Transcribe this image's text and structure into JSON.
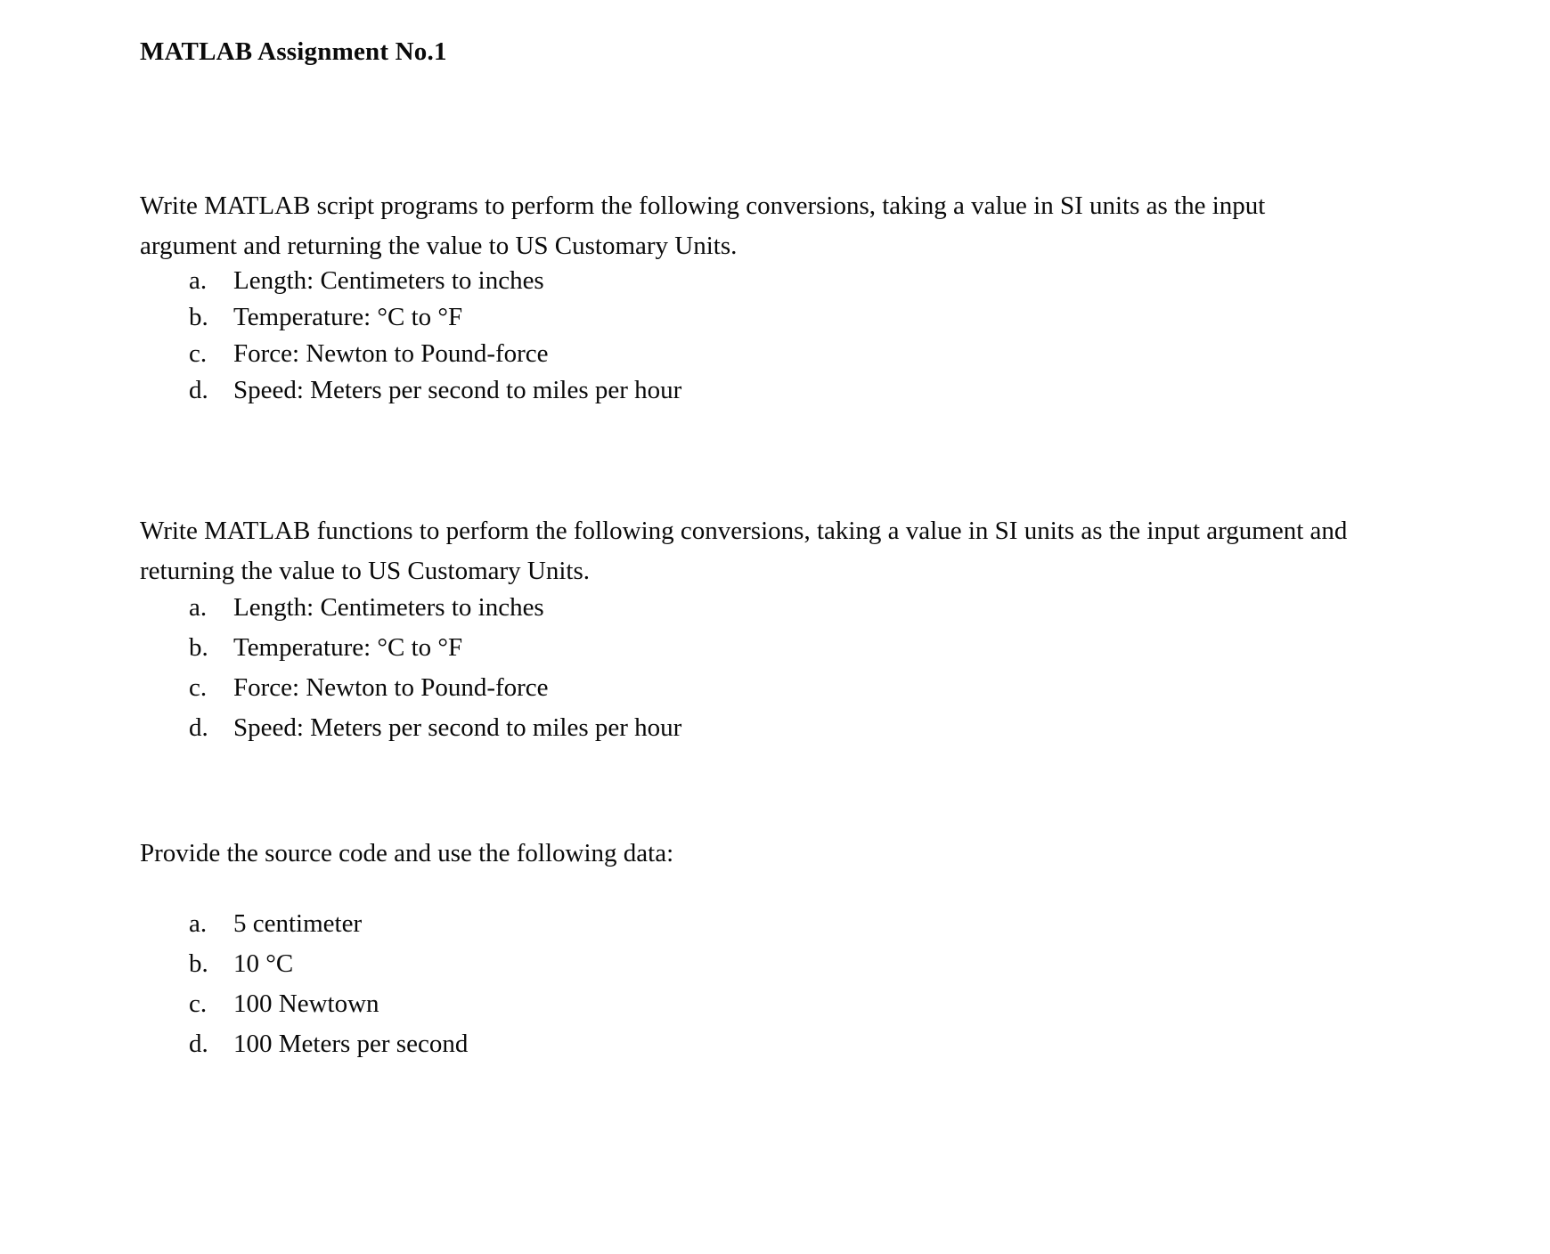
{
  "document": {
    "title": "MATLAB Assignment No.1",
    "sections": [
      {
        "id": "scripts",
        "paragraph": "Write MATLAB script programs to perform the following conversions, taking a value in SI units as the input argument and returning the value to US Customary Units.",
        "items": [
          {
            "marker": "a.",
            "text": "Length: Centimeters to inches"
          },
          {
            "marker": "b.",
            "text": "Temperature: °C to °F"
          },
          {
            "marker": "c.",
            "text": "Force: Newton to Pound-force"
          },
          {
            "marker": "d.",
            "text": "Speed: Meters per second to miles per hour"
          }
        ]
      },
      {
        "id": "functions",
        "paragraph": "Write MATLAB functions to perform the following conversions, taking a value in SI units as the input argument and returning the value to US Customary Units.",
        "items": [
          {
            "marker": "a.",
            "text": "Length: Centimeters to inches"
          },
          {
            "marker": "b.",
            "text": "Temperature: °C to °F"
          },
          {
            "marker": "c.",
            "text": "Force: Newton to Pound-force"
          },
          {
            "marker": "d.",
            "text": "Speed: Meters per second to miles per hour"
          }
        ]
      },
      {
        "id": "data",
        "paragraph": "Provide the source code and use the following data:",
        "items": [
          {
            "marker": "a.",
            "text": "5 centimeter"
          },
          {
            "marker": "b.",
            "text": "10 °C"
          },
          {
            "marker": "c.",
            "text": "100 Newtown"
          },
          {
            "marker": "d.",
            "text": "100 Meters per second"
          }
        ]
      }
    ]
  }
}
